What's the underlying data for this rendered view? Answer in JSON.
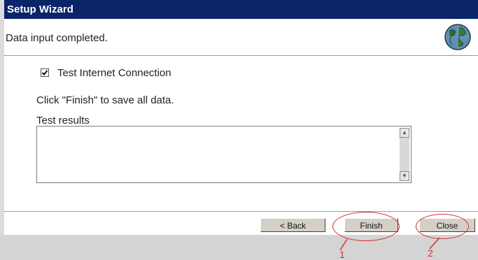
{
  "window": {
    "title": "Setup Wizard"
  },
  "header": {
    "message": "Data input completed.",
    "icon": "globe-icon"
  },
  "content": {
    "checkbox_label": "Test Internet Connection",
    "checkbox_checked": true,
    "hint": "Click \"Finish\" to save all data.",
    "results_label": "Test results",
    "results_value": ""
  },
  "buttons": {
    "back": "< Back",
    "finish": "Finish",
    "close": "Close"
  },
  "annotations": {
    "label_1": "1",
    "label_2": "2",
    "color": "#d23030"
  },
  "colors": {
    "titlebar": "#0a246a",
    "button_face": "#d4d0c8"
  }
}
